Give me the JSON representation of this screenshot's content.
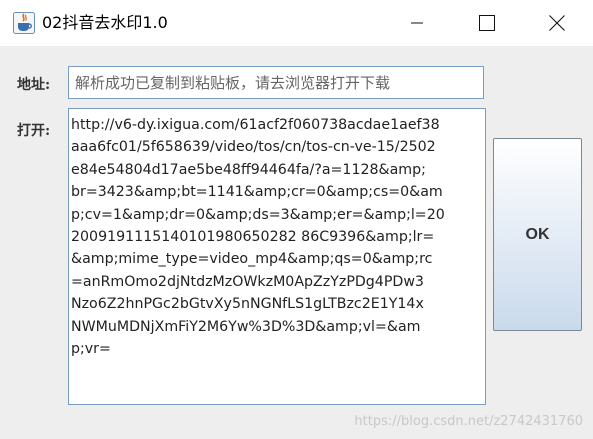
{
  "window": {
    "title": "02抖音去水印1.0",
    "icon": "java-coffee-cup-icon",
    "controls": [
      "minimize-icon",
      "maximize-icon",
      "close-icon"
    ]
  },
  "form": {
    "address_label": "地址:",
    "address_placeholder": "解析成功已复制到粘贴板，请去浏览器打开下载",
    "open_label": "打开:",
    "result_lines": [
      "http://v6-dy.ixigua.com/61acf2f060738acdae1aef38",
      "aaa6fc01/5f658639/video/tos/cn/tos-cn-ve-15/2502",
      "e84e54804d17ae5be48ff94464fa/?a=1128&amp;",
      "br=3423&amp;bt=1141&amp;cr=0&amp;cs=0&am",
      "p;cv=1&amp;dr=0&amp;ds=3&amp;er=&amp;l=20",
      "2009191115140101980650282 86C9396&amp;lr=",
      "&amp;mime_type=video_mp4&amp;qs=0&amp;rc",
      "=anRmOmo2djNtdzMzOWkzM0ApZzYzPDg4PDw3",
      "Nzo6Z2hnPGc2bGtvXy5nNGNfLS1gLTBzc2E1Y14x",
      "NWMuMDNjXmFiY2M6Yw%3D%3D&amp;vl=&am",
      "p;vr="
    ]
  },
  "buttons": {
    "ok_label": "OK"
  },
  "watermark": "https://blog.csdn.net/z2742431760",
  "colors": {
    "client_background": "#eeeeee",
    "field_border": "#7a9cc4",
    "button_gradient_top": "#ffffff",
    "button_gradient_bottom": "#c9daec"
  }
}
